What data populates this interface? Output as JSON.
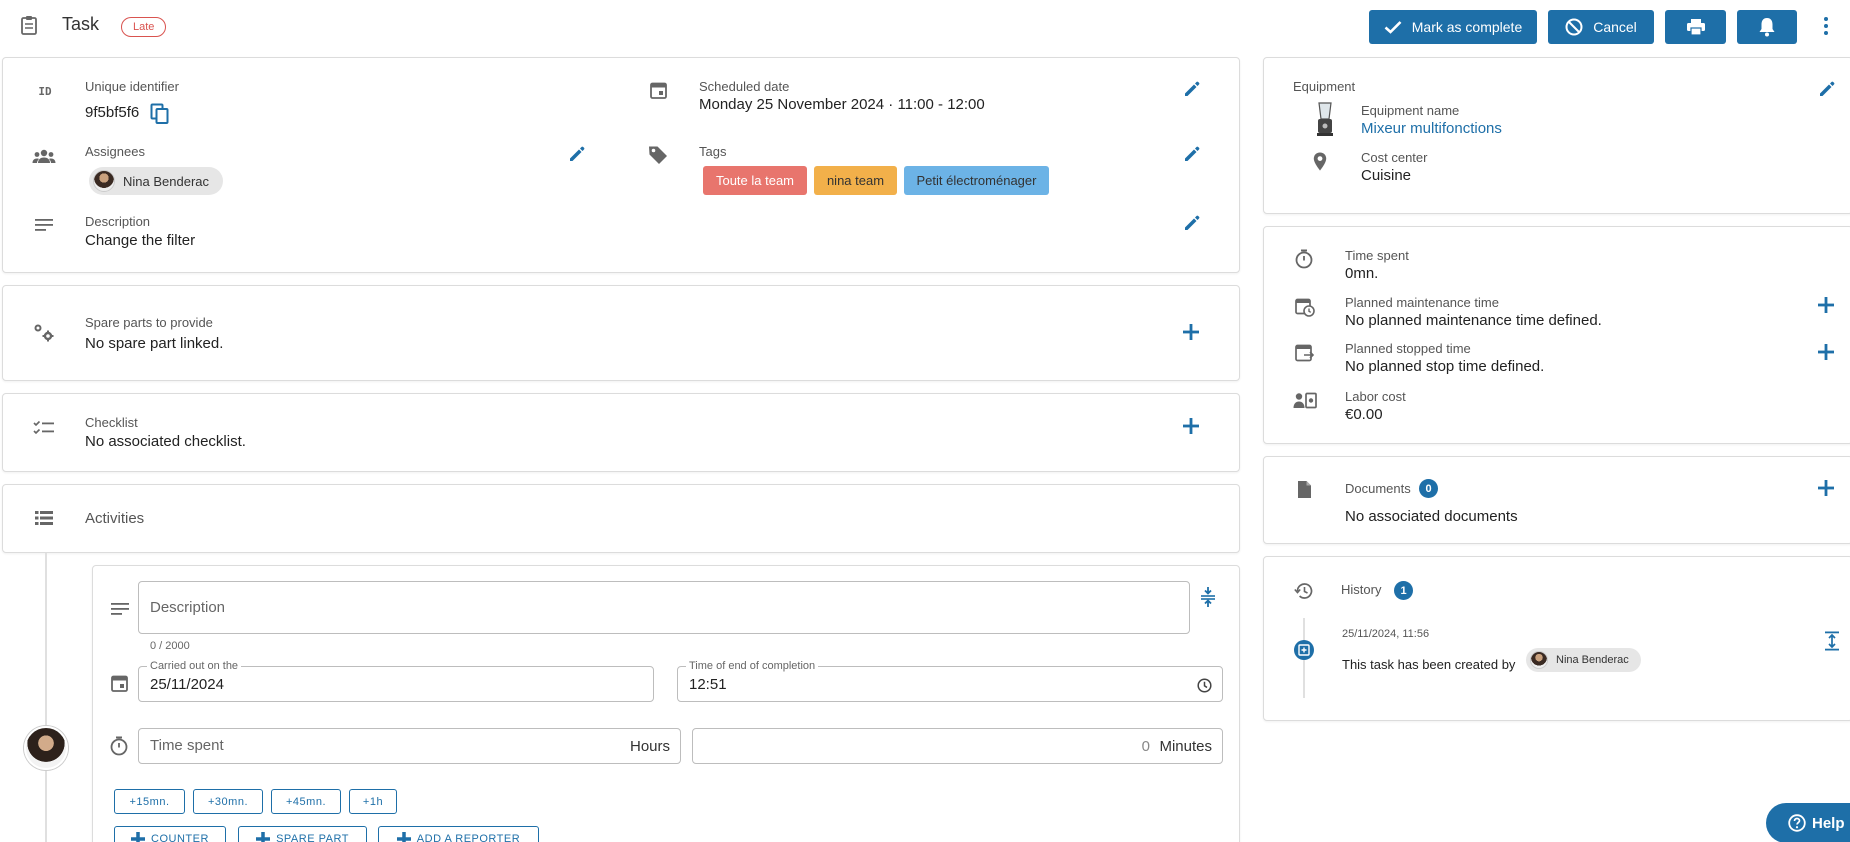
{
  "header": {
    "title": "Task",
    "status_badge": "Late",
    "buttons": {
      "mark_complete": "Mark as complete",
      "cancel": "Cancel"
    }
  },
  "details": {
    "unique_id_label": "Unique identifier",
    "unique_id_icon_text": "ID",
    "unique_id_value": "9f5bf5f6",
    "scheduled_label": "Scheduled date",
    "scheduled_value": "Monday 25 November 2024 · 11:00 - 12:00",
    "assignees_label": "Assignees",
    "assignee_name": "Nina Benderac",
    "tags_label": "Tags",
    "tags": [
      {
        "label": "Toute la team",
        "bg": "#e8756d",
        "fg": "#ffffff"
      },
      {
        "label": "nina team",
        "bg": "#f2b04a",
        "fg": "#333333"
      },
      {
        "label": "Petit électroménager",
        "bg": "#6cb3e6",
        "fg": "#333333"
      }
    ],
    "description_label": "Description",
    "description_value": "Change the filter"
  },
  "spare_parts": {
    "label": "Spare parts to provide",
    "value": "No spare part linked."
  },
  "checklist": {
    "label": "Checklist",
    "value": "No associated checklist."
  },
  "activities": {
    "label": "Activities",
    "form": {
      "description_placeholder": "Description",
      "char_count": "0 / 2000",
      "carried_out_legend": "Carried out on the",
      "carried_out_value": "25/11/2024",
      "end_time_legend": "Time of end of completion",
      "end_time_value": "12:51",
      "time_spent_placeholder": "Time spent",
      "hours_suffix": "Hours",
      "minutes_value": "0",
      "minutes_suffix": "Minutes",
      "quick_buttons": [
        "+15mn.",
        "+30mn.",
        "+45mn.",
        "+1h"
      ],
      "action_buttons": [
        "COUNTER",
        "SPARE PART",
        "ADD A REPORTER"
      ]
    }
  },
  "equipment": {
    "section_label": "Equipment",
    "name_label": "Equipment name",
    "name_value": "Mixeur multifonctions",
    "cost_center_label": "Cost center",
    "cost_center_value": "Cuisine"
  },
  "time": {
    "spent_label": "Time spent",
    "spent_value": "0mn.",
    "planned_maint_label": "Planned maintenance time",
    "planned_maint_value": "No planned maintenance time defined.",
    "planned_stop_label": "Planned stopped time",
    "planned_stop_value": "No planned stop time defined.",
    "labor_label": "Labor cost",
    "labor_value": "€0.00"
  },
  "documents": {
    "label": "Documents",
    "count": "0",
    "value": "No associated documents"
  },
  "history": {
    "label": "History",
    "count": "1",
    "entry_time": "25/11/2024, 11:56",
    "entry_text": "This task has been created by",
    "entry_user": "Nina Benderac"
  },
  "help": {
    "label": "Help"
  },
  "colors": {
    "accent": "#1e6fa8",
    "late": "#d9534f"
  }
}
